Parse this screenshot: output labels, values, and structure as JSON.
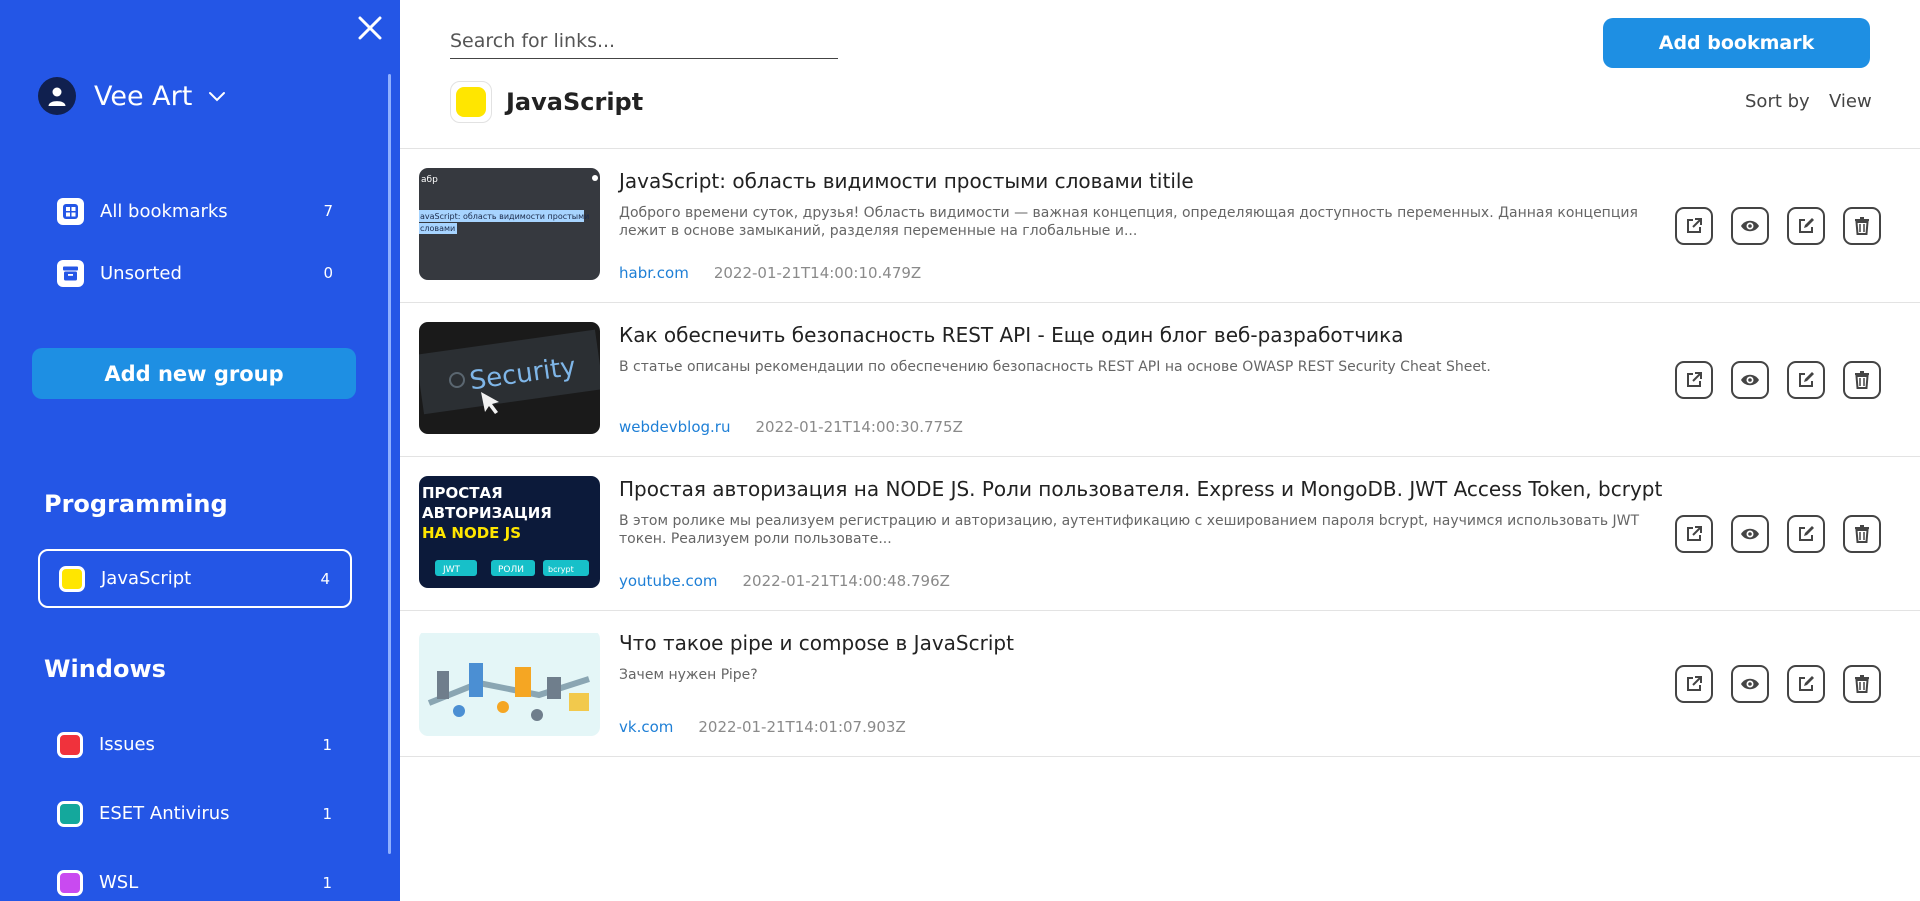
{
  "colors": {
    "sidebar": "#2456e6",
    "accent": "#1e8fe3",
    "link": "#1e7fd6"
  },
  "user": {
    "name": "Vee Art"
  },
  "nav": [
    {
      "label": "All bookmarks",
      "count": "7",
      "icon": "grid-icon"
    },
    {
      "label": "Unsorted",
      "count": "0",
      "icon": "archive-icon"
    }
  ],
  "add_group_label": "Add new group",
  "groups": [
    {
      "title": "Programming",
      "items": [
        {
          "label": "JavaScript",
          "count": "4",
          "color": "#ffe600",
          "active": true
        }
      ]
    },
    {
      "title": "Windows",
      "items": [
        {
          "label": "Issues",
          "count": "1",
          "color": "#f0323c"
        },
        {
          "label": "ESET Antivirus",
          "count": "1",
          "color": "#14a89c"
        },
        {
          "label": "WSL",
          "count": "1",
          "color": "#c94af0"
        }
      ]
    }
  ],
  "search": {
    "placeholder": "Search for links..."
  },
  "add_bookmark_label": "Add bookmark",
  "current_group": {
    "title": "JavaScript",
    "color": "#ffe600"
  },
  "sort_label": "Sort by",
  "view_label": "View",
  "bookmarks": [
    {
      "title": "JavaScript: область видимости простыми словами titile",
      "description": "Доброго времени суток, друзья! Область видимости — важная концепция, определяющая доступность переменных. Данная концепция лежит в основе замыканий, разделяя переменные на глобальные и...",
      "domain": "habr.com",
      "date": "2022-01-21T14:00:10.479Z",
      "thumb_text": [
        "абр",
        "avaScript: область видимости простыми",
        "словами"
      ]
    },
    {
      "title": "Как обеспечить безопасность REST API - Еще один блог веб-разработчика",
      "description": "В статье описаны рекомендации по обеспечению безопасность REST API на основе OWASP REST Security Cheat Sheet.",
      "domain": "webdevblog.ru",
      "date": "2022-01-21T14:00:30.775Z",
      "thumb_text": [
        "Security"
      ]
    },
    {
      "title": "Простая авторизация на NODE JS. Роли пользователя. Express и MongoDB. JWT Access Token, bcrypt",
      "description": "В этом ролике мы реализуем регистрацию и авторизацию, аутентификацию с хешированием пароля bcrypt, научимся использовать JWT токен. Реализуем роли пользовате...",
      "domain": "youtube.com",
      "date": "2022-01-21T14:00:48.796Z",
      "thumb_text": [
        "ПРОСТАЯ",
        "АВТОРИЗАЦИЯ",
        "НА NODE JS",
        "JWT",
        "РОЛИ",
        "bcrypt"
      ]
    },
    {
      "title": "Что такое pipe и compose в JavaScript",
      "description": "Зачем нужен Pipe?",
      "domain": "vk.com",
      "date": "2022-01-21T14:01:07.903Z",
      "thumb_text": []
    }
  ]
}
